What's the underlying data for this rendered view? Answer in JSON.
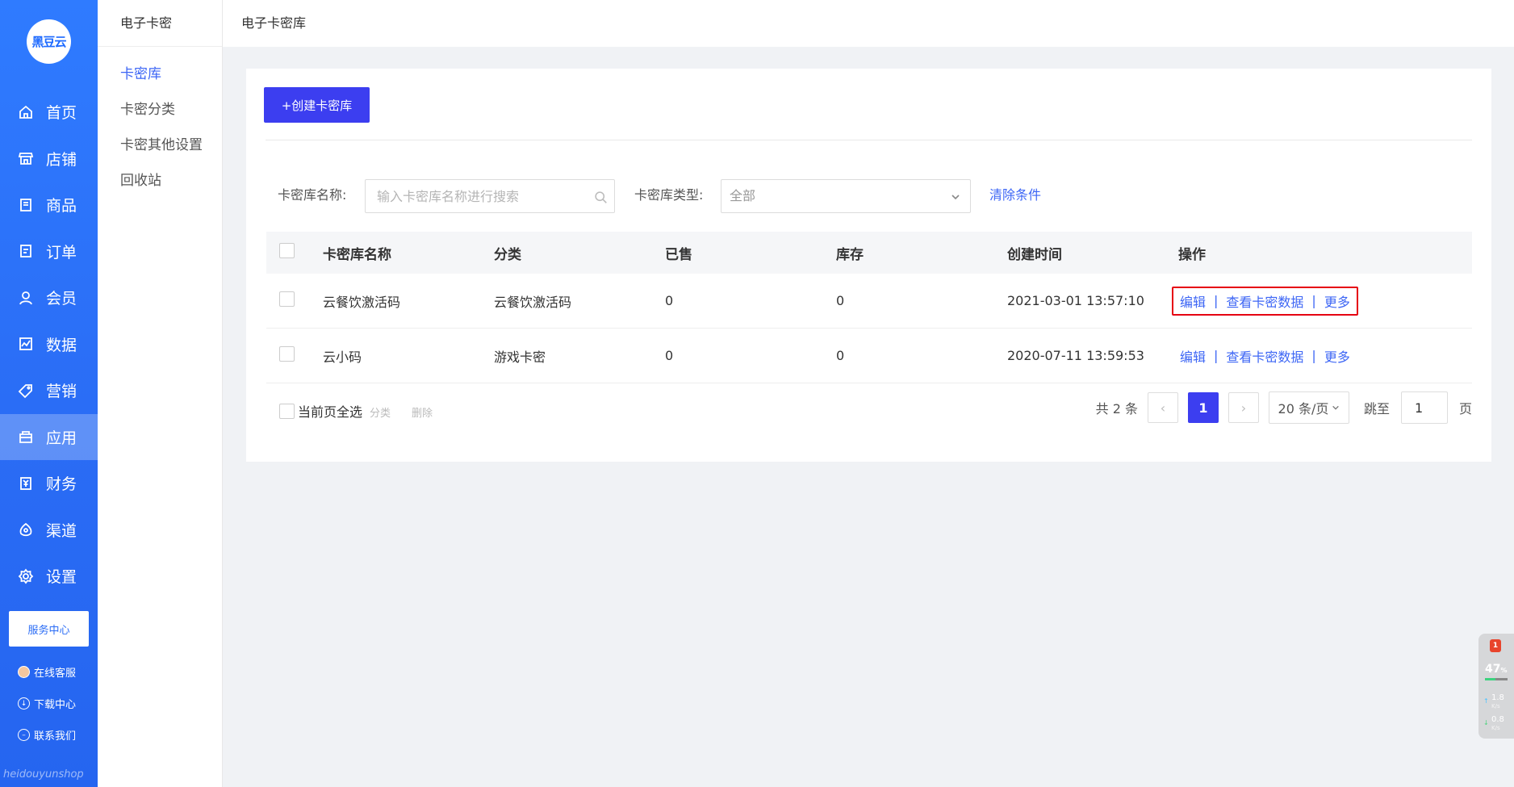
{
  "nav": {
    "logo_text": "黑豆云",
    "items": [
      {
        "label": "首页",
        "icon": "home-icon"
      },
      {
        "label": "店铺",
        "icon": "store-icon"
      },
      {
        "label": "商品",
        "icon": "goods-icon"
      },
      {
        "label": "订单",
        "icon": "order-icon"
      },
      {
        "label": "会员",
        "icon": "member-icon"
      },
      {
        "label": "数据",
        "icon": "data-icon"
      },
      {
        "label": "营销",
        "icon": "tag-icon"
      },
      {
        "label": "应用",
        "icon": "app-icon"
      },
      {
        "label": "财务",
        "icon": "finance-icon"
      },
      {
        "label": "渠道",
        "icon": "channel-icon"
      },
      {
        "label": "设置",
        "icon": "gear-icon"
      }
    ],
    "active_index": 7,
    "service_center": "服务中心",
    "online_service": "在线客服",
    "download_center": "下载中心",
    "contact_us": "联系我们",
    "brand_footer": "heidouyunshop"
  },
  "submenu": {
    "title": "电子卡密",
    "items": [
      "卡密库",
      "卡密分类",
      "卡密其他设置",
      "回收站"
    ],
    "active_index": 0
  },
  "header": {
    "breadcrumb": "电子卡密库"
  },
  "toolbar": {
    "create_label": "+创建卡密库"
  },
  "filters": {
    "name_label": "卡密库名称:",
    "name_placeholder": "输入卡密库名称进行搜索",
    "type_label": "卡密库类型:",
    "type_value": "全部",
    "clear_label": "清除条件"
  },
  "table": {
    "columns": [
      "卡密库名称",
      "分类",
      "已售",
      "库存",
      "创建时间",
      "操作"
    ],
    "rows": [
      {
        "name": "云餐饮激活码",
        "category": "云餐饮激活码",
        "sold": "0",
        "stock": "0",
        "created": "2021-03-01 13:57:10"
      },
      {
        "name": "云小码",
        "category": "游戏卡密",
        "sold": "0",
        "stock": "0",
        "created": "2020-07-11 13:59:53"
      }
    ],
    "actions": {
      "edit": "编辑",
      "view": "查看卡密数据",
      "more": "更多",
      "separator": "|"
    }
  },
  "footer": {
    "select_all": "当前页全选",
    "batch_category": "分类",
    "batch_delete": "删除",
    "total": "共 2 条",
    "prev": "‹",
    "current_page": "1",
    "next": "›",
    "page_size": "20 条/页",
    "jump_label": "跳至",
    "jump_value": "1",
    "page_suffix": "页"
  },
  "widget": {
    "badge": "1",
    "percent": "47",
    "percent_unit": "%",
    "cpu_fraction": 0.47,
    "up_speed": "1.8",
    "down_speed": "0.8",
    "speed_unit": "K/s"
  },
  "colors": {
    "nav_blue": "#2a6cf5",
    "primary": "#3c3ef0",
    "link": "#3d66f5",
    "highlight_border": "#e60012"
  }
}
